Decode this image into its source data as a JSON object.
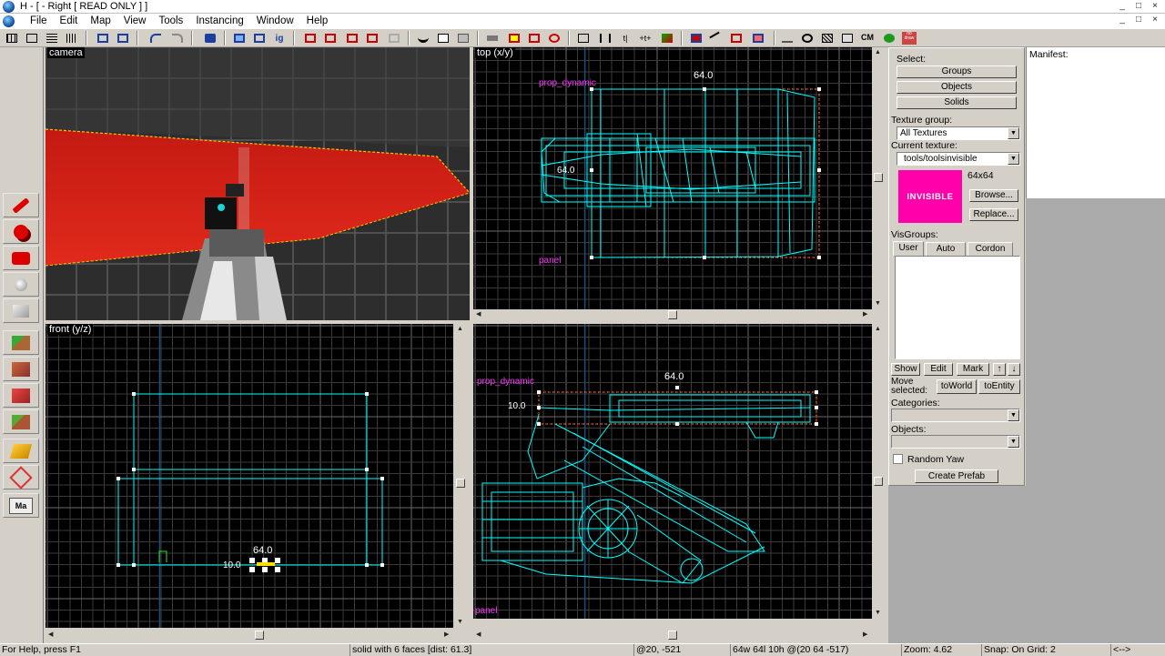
{
  "app": {
    "title": "H - [ - Right [ READ ONLY ] ]",
    "window_buttons": [
      "_",
      "□",
      "×"
    ],
    "mdi_buttons": [
      "_",
      "□",
      "×"
    ]
  },
  "menu": [
    "File",
    "Edit",
    "Map",
    "View",
    "Tools",
    "Instancing",
    "Window",
    "Help"
  ],
  "toolbar": {
    "cm_label": "CM",
    "nodraw_label": "no\ndraw"
  },
  "viewports": {
    "camera": {
      "label": "camera"
    },
    "top": {
      "label": "top (x/y)",
      "dim_label": "64.0",
      "side_label": "64.0",
      "entity_label": "prop_dynamic",
      "entity2_label": "panel"
    },
    "front": {
      "label": "front (y/z)",
      "dim_label": "64.0",
      "side_label": "10.0"
    },
    "side": {
      "label": "",
      "dim_label": "64.0",
      "side_label": "10.0",
      "entity_label": "prop_dynamic",
      "entity2_label": "panel"
    }
  },
  "panel": {
    "select_label": "Select:",
    "groups_button": "Groups",
    "objects_button": "Objects",
    "solids_button": "Solids",
    "texture_group_label": "Texture group:",
    "texture_group_value": "All Textures",
    "current_texture_label": "Current texture:",
    "current_texture_value": "tools/toolsinvisible",
    "texture_size": "64x64",
    "texture_name": "INVISIBLE",
    "browse_button": "Browse...",
    "replace_button": "Replace...",
    "visgroups_label": "VisGroups:",
    "tabs": [
      "User",
      "Auto",
      "Cordon"
    ],
    "show_button": "Show",
    "edit_button": "Edit",
    "mark_button": "Mark",
    "up_button": "↑",
    "down_button": "↓",
    "move_selected_label": "Move\nselected:",
    "to_world_button": "toWorld",
    "to_entity_button": "toEntity",
    "categories_label": "Categories:",
    "objects_label": "Objects:",
    "random_yaw_label": "Random Yaw",
    "random_yaw_checked": false,
    "create_prefab_button": "Create Prefab",
    "manifest_label": "Manifest:"
  },
  "status": {
    "help": "For Help, press F1",
    "selection": "solid with 6 faces  [dist: 61.3]",
    "cursor": "@20, -521",
    "size": "64w 64l 10h @(20 64 -517)",
    "zoom": "Zoom: 4.62",
    "snap": "Snap: On Grid: 2",
    "nav": "<-->"
  },
  "colors": {
    "wire": "#00ffff",
    "grid": "#3a3a3a",
    "grid_major": "#6a6a6a",
    "entity_label": "#ff33ff",
    "texture_swatch": "#ff00aa"
  }
}
